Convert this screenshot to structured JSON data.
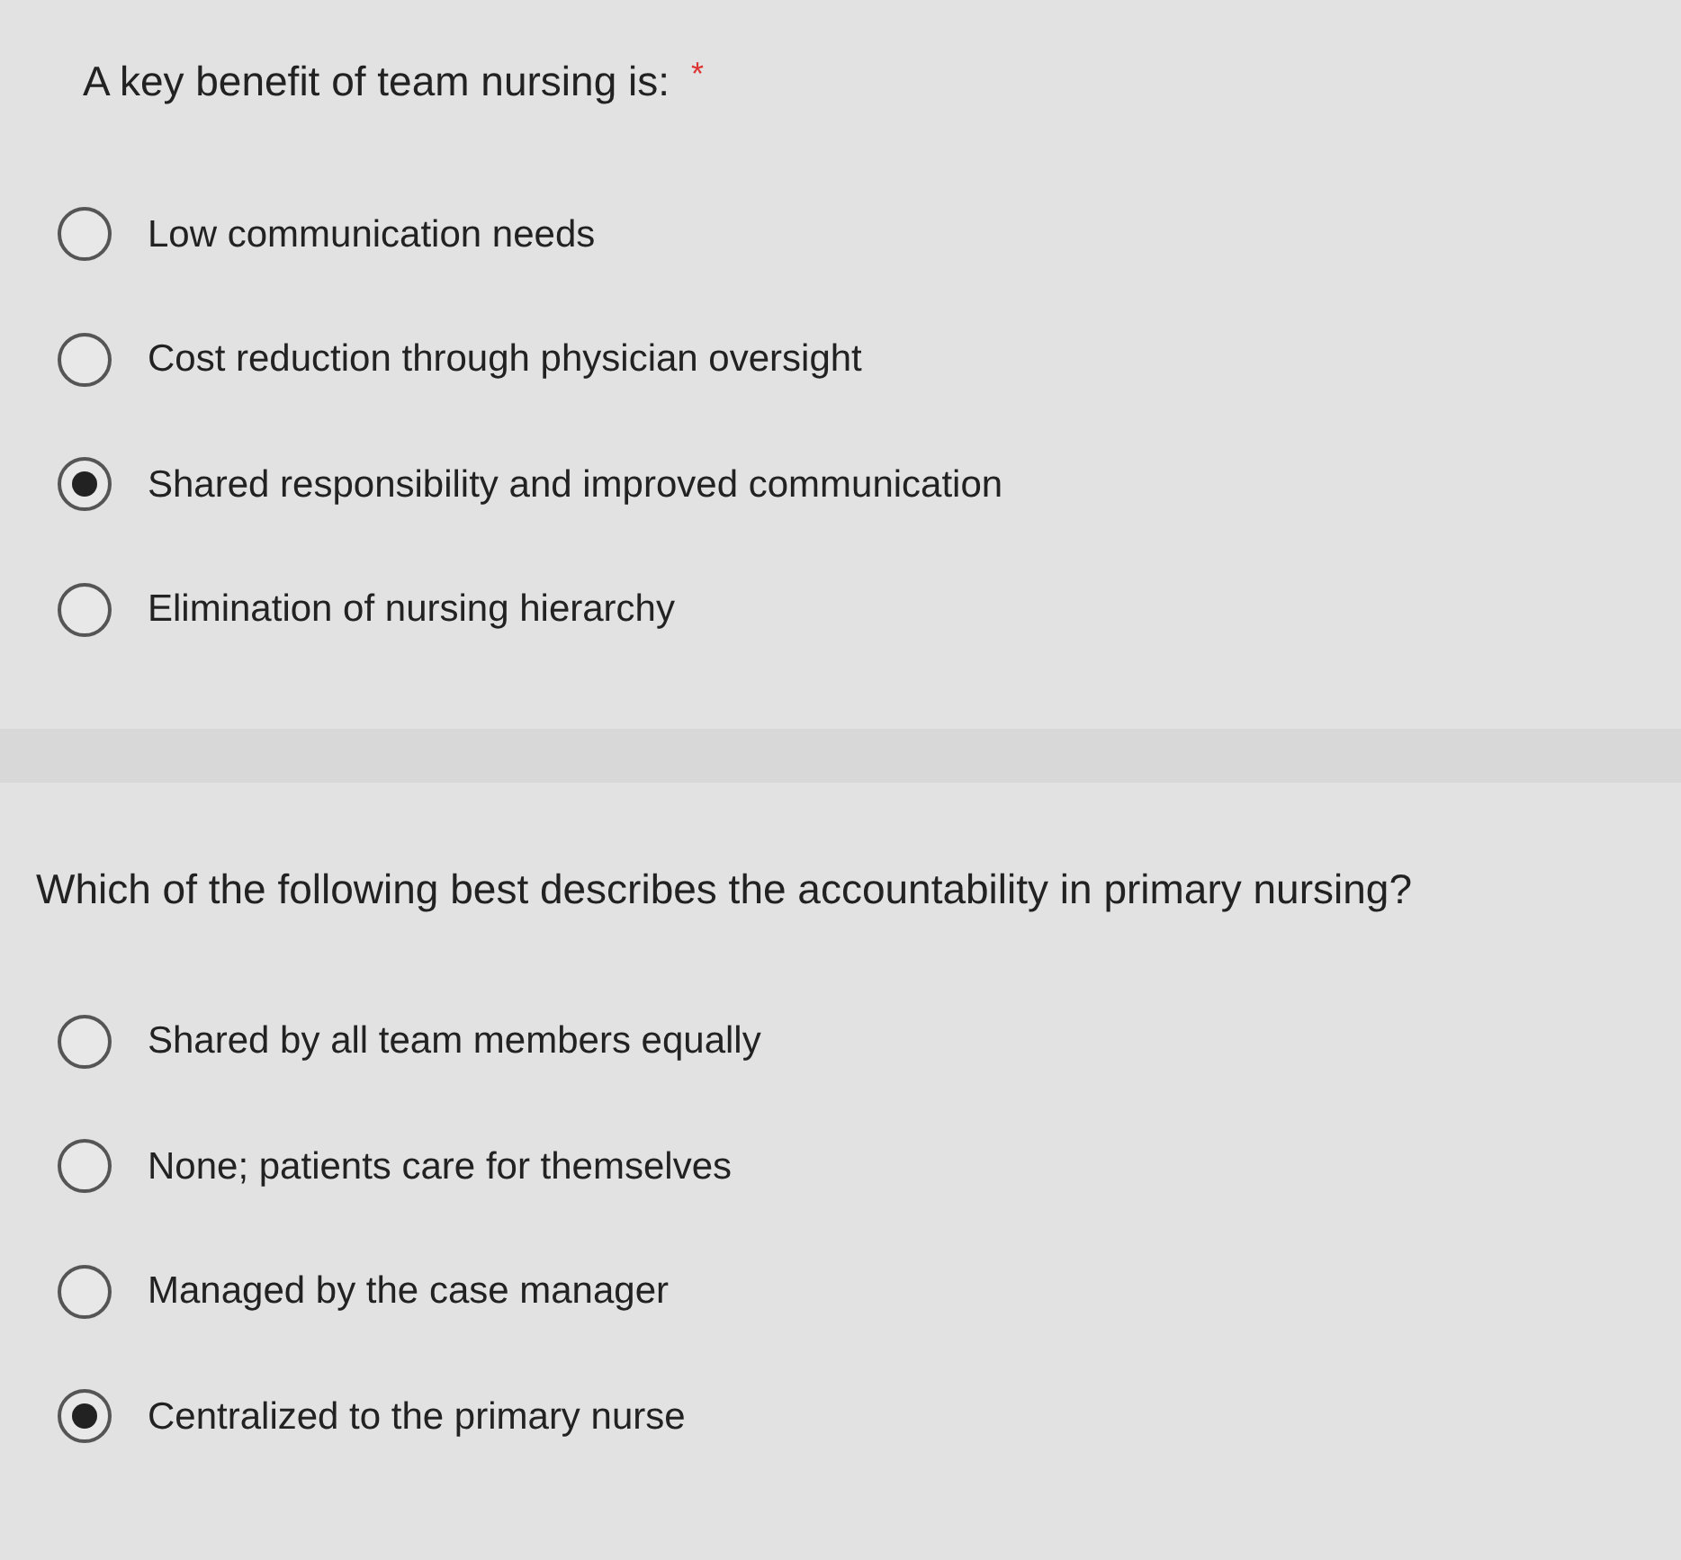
{
  "questions": [
    {
      "title": "A key benefit of team nursing is:",
      "required_mark": "*",
      "options": [
        {
          "label": "Low communication needs",
          "selected": false
        },
        {
          "label": "Cost reduction through physician oversight",
          "selected": false
        },
        {
          "label": "Shared responsibility and improved communication",
          "selected": true
        },
        {
          "label": "Elimination of nursing hierarchy",
          "selected": false
        }
      ]
    },
    {
      "title": "Which of the following best describes the accountability in primary nursing?",
      "options": [
        {
          "label": "Shared by all team members equally",
          "selected": false
        },
        {
          "label": "None; patients care for themselves",
          "selected": false
        },
        {
          "label": "Managed by the case manager",
          "selected": false
        },
        {
          "label": "Centralized to the primary nurse",
          "selected": true
        }
      ]
    }
  ]
}
